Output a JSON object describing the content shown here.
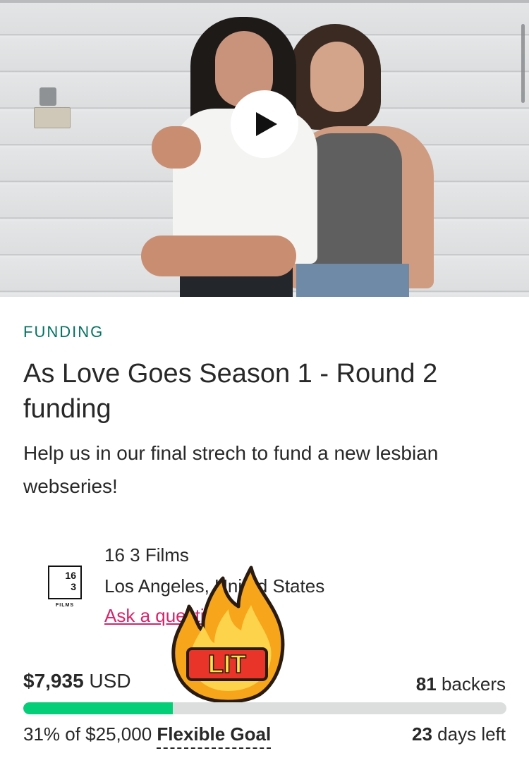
{
  "hero": {
    "play_icon": "play-icon"
  },
  "project": {
    "status": "FUNDING",
    "title": "As Love Goes Season 1 - Round 2 funding",
    "blurb": "Help us in our final strech to fund a new lesbian webseries!"
  },
  "creator": {
    "logo_number_top": "16",
    "logo_number_bottom": "3",
    "logo_subtext": "FILMS",
    "name": "16 3 Films",
    "location": "Los Angeles, United States",
    "ask_link": "Ask a question"
  },
  "sticker": {
    "text": "LIT",
    "icon": "fire-icon"
  },
  "funding": {
    "pledged_amount": "$7,935",
    "pledged_currency": "USD",
    "backers_count": "81",
    "backers_label": "backers",
    "percent_funded": 0.31,
    "percent_text": "31% of $25,000",
    "goal_type": "Flexible Goal",
    "days_count": "23",
    "days_label": "days left"
  },
  "colors": {
    "status_green": "#037362",
    "progress_green": "#05ce78",
    "link_pink": "#d6256a",
    "text": "#282828"
  }
}
